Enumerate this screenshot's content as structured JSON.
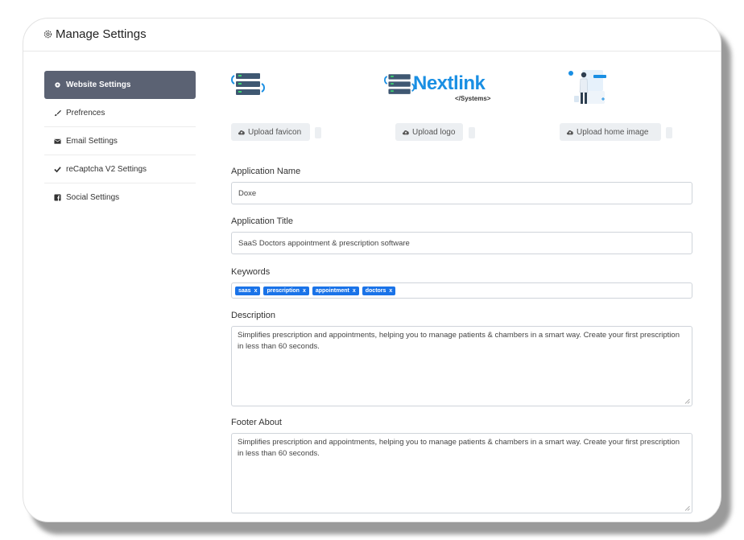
{
  "header": {
    "title": "Manage Settings"
  },
  "sidebar": {
    "items": [
      {
        "label": "Website Settings",
        "icon": "gear-icon",
        "active": true
      },
      {
        "label": "Prefrences",
        "icon": "brush-icon",
        "active": false
      },
      {
        "label": "Email Settings",
        "icon": "envelope-icon",
        "active": false
      },
      {
        "label": "reCaptcha V2 Settings",
        "icon": "check-icon",
        "active": false
      },
      {
        "label": "Social Settings",
        "icon": "facebook-icon",
        "active": false
      }
    ]
  },
  "uploads": {
    "favicon_label": "Upload favicon",
    "logo_label": "Upload logo",
    "home_image_label": "Upload home image",
    "logo_text": "Nextlink",
    "logo_subtext": "</Systems>"
  },
  "form": {
    "app_name_label": "Application Name",
    "app_name_value": "Doxe",
    "app_title_label": "Application Title",
    "app_title_value": "SaaS Doctors appointment & prescription software",
    "keywords_label": "Keywords",
    "keywords": [
      "saas",
      "prescription",
      "appointment",
      "doctors"
    ],
    "tag_remove": "x",
    "description_label": "Description",
    "description_value": "Simplifies prescription and appointments, helping you to manage patients & chambers in a smart way. Create your first prescription in less than 60 seconds.",
    "footer_label": "Footer About",
    "footer_value": "Simplifies prescription and appointments, helping you to manage patients & chambers in a smart way. Create your first prescription in less than 60 seconds."
  },
  "colors": {
    "accent": "#1a73e8",
    "sidebar_active": "#5b6273",
    "logo_blue": "#1a8fe3"
  }
}
